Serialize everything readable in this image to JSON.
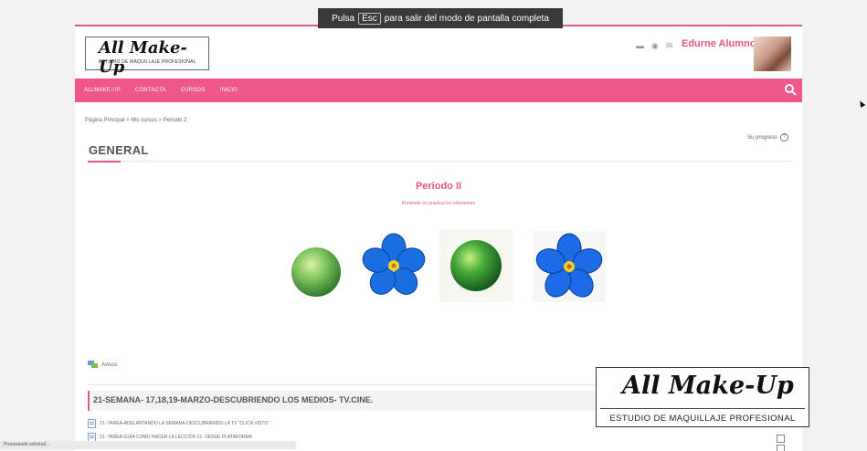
{
  "fullscreen_banner": {
    "pre": "Pulsa",
    "key": "Esc",
    "post": "para salir del modo de pantalla completa"
  },
  "header": {
    "logo_text": "All Make-Up",
    "logo_subtitle": "ESTUDIO DE MAQUILLAJE PROFESIONAL",
    "user_name": "Edurne Alumno ˅",
    "icons": [
      "chat-icon",
      "bell-icon",
      "mail-icon"
    ]
  },
  "nav": {
    "items": [
      "ALLMAKE-UP",
      "CONTACTA",
      "CURSOS",
      "INICIO"
    ],
    "color": "#f0588a"
  },
  "breadcrumb": "Página Principal > Mis cursos > Periodo 2",
  "progress_label": "Su progreso",
  "section": {
    "title": "GENERAL"
  },
  "period": {
    "title": "Periodo II",
    "subtitle": "Poniendo en practica los volumenes"
  },
  "avisos_label": "Avisos",
  "week": {
    "title": "21-SEMANA- 17,18,19-MARZO-DESCUBRIENDO LOS MEDIOS- TV.CINE.",
    "activities": [
      "21.-TAREA-ADELANTANDO LA SEMANA-DESCUBRIENDO LA TV \"CLICA VISTO \".",
      "21.-TAREA-GUÍA COMO HACER LA LECCIÓN 21- DESDE PLATAFORMA"
    ]
  },
  "watermark": {
    "text": "All Make-Up",
    "subtitle": "ESTUDIO DE MAQUILLAJE PROFESIONAL"
  },
  "status_bar": "Procesando solicitud...",
  "accent_color": "#e4577f"
}
